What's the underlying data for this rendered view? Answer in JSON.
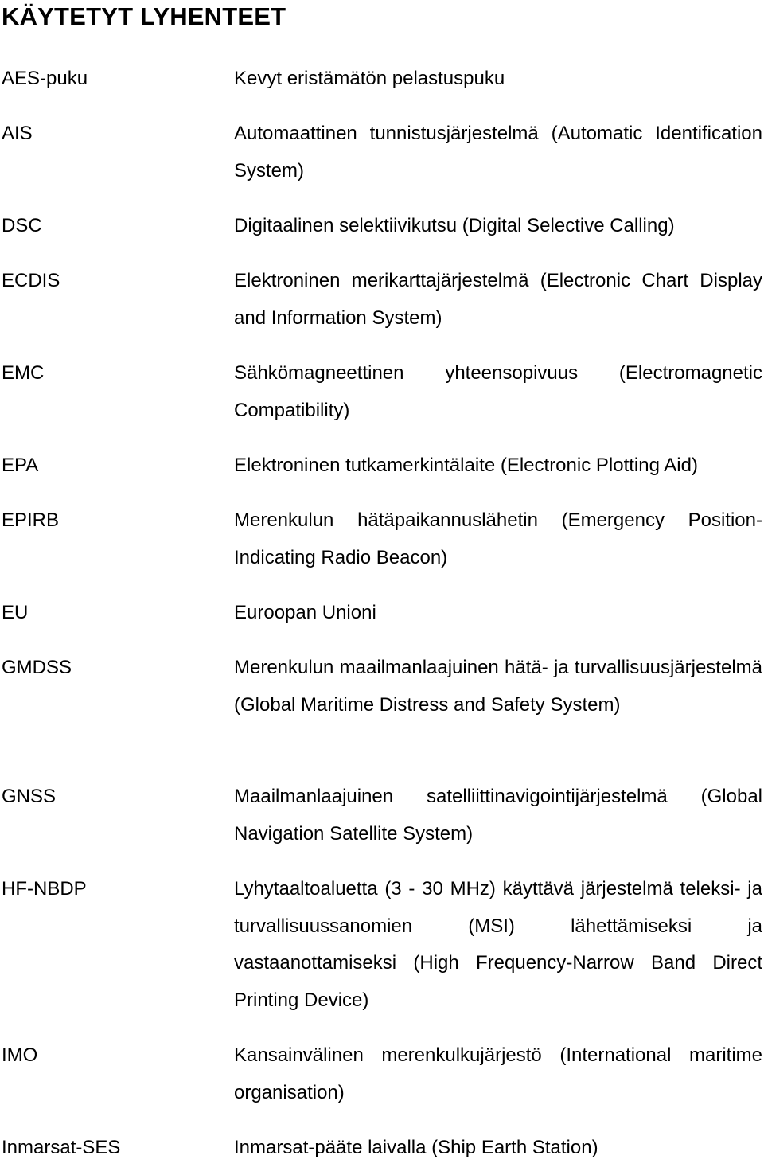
{
  "page": {
    "title": "KÄYTETYT LYHENTEET"
  },
  "entries": [
    {
      "abbr": "AES-puku",
      "definition": "Kevyt eristämätön pelastuspuku"
    },
    {
      "abbr": "AIS",
      "definition": "Automaattinen tunnistusjärjestelmä (Automatic Identification System)"
    },
    {
      "abbr": "DSC",
      "definition": "Digitaalinen selektiivikutsu (Digital Selective Calling)"
    },
    {
      "abbr": "ECDIS",
      "definition": "Elektroninen merikarttajärjestelmä (Electronic Chart Display and Information System)"
    },
    {
      "abbr": "EMC",
      "definition": "Sähkömagneettinen yhteensopivuus (Electromagnetic Compatibility)"
    },
    {
      "abbr": "EPA",
      "definition": "Elektroninen tutkamerkintälaite (Electronic Plotting Aid)"
    },
    {
      "abbr": "EPIRB",
      "definition": "Merenkulun hätäpaikannuslähetin (Emergency Position-Indicating Radio Beacon)"
    },
    {
      "abbr": "EU",
      "definition": "Euroopan Unioni"
    },
    {
      "abbr": "GMDSS",
      "definition": "Merenkulun maailmanlaajuinen hätä- ja turvallisuusjärjestelmä (Global Maritime Distress and Safety System)"
    },
    {
      "abbr": "GNSS",
      "definition": "Maailmanlaajuinen satelliittinavigointijärjestelmä (Global Navigation Satellite System)"
    },
    {
      "abbr": "HF-NBDP",
      "definition": "Lyhytaaltoaluetta (3 - 30 MHz) käyttävä järjestelmä teleksi- ja turvallisuussanomien (MSI) lähettämiseksi ja vastaanottamiseksi (High Frequency-Narrow Band Direct Printing Device)"
    },
    {
      "abbr": "IMO",
      "definition": "Kansainvälinen merenkulkujärjestö (International maritime organisation)"
    },
    {
      "abbr": "Inmarsat-SES",
      "definition": "Inmarsat-pääte laivalla (Ship Earth Station)"
    }
  ]
}
